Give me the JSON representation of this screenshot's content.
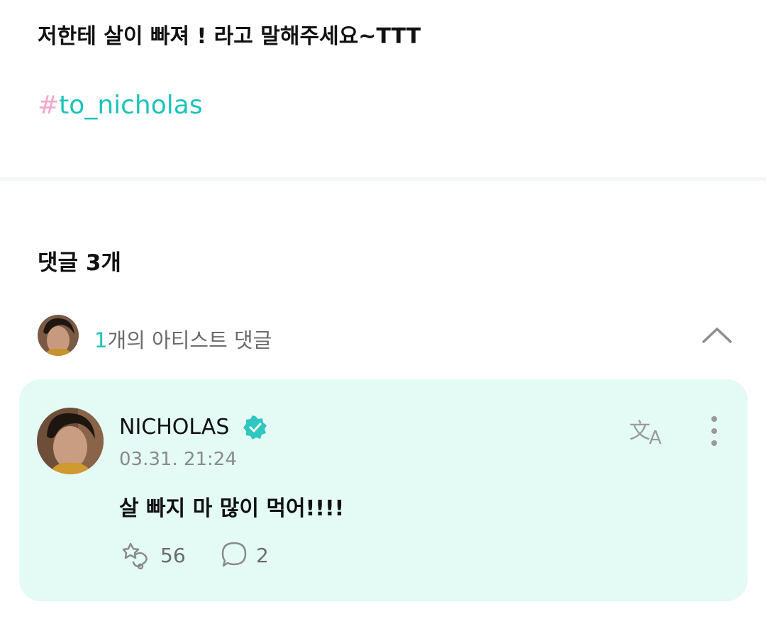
{
  "post": {
    "text": "저한테 살이 빠져 !  라고 말해주세요~TTT",
    "hashtag_symbol": "#",
    "hashtag_text": "to_nicholas"
  },
  "comments": {
    "title": "댓글 3개",
    "artist_summary": {
      "count": "1",
      "label": "개의 아티스트 댓글"
    },
    "items": [
      {
        "author": "NICHOLAS",
        "verified": true,
        "timestamp": "03.31. 21:24",
        "body": "살 빠지 마 많이 먹어!!!!",
        "likes": "56",
        "replies": "2"
      }
    ]
  },
  "icons": {
    "verified": "verified-badge-icon",
    "translate": "translate-icon",
    "more": "more-vertical-icon",
    "like": "like-icon",
    "reply": "reply-bubble-icon",
    "collapse": "chevron-up-icon"
  },
  "colors": {
    "accent": "#1cc3bb",
    "hash_pink": "#f4a7c8",
    "card_background": "#e4faf5",
    "muted_text": "#8a8a8a"
  }
}
